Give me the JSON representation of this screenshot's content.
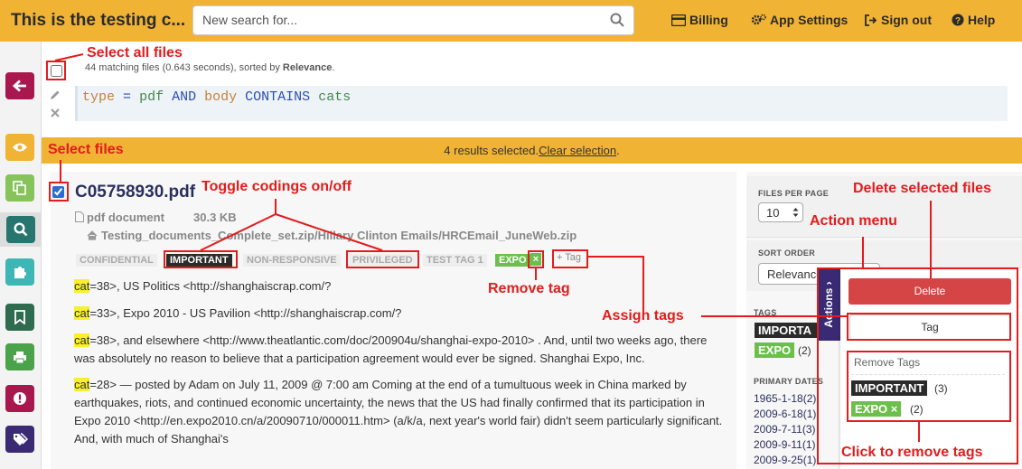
{
  "header": {
    "title": "This is the testing c...",
    "search_placeholder": "New search for...",
    "nav": {
      "billing": "Billing",
      "app_settings": "App Settings",
      "sign_out": "Sign out",
      "help": "Help"
    }
  },
  "results": {
    "summary_prefix": "44 matching files (0.643 seconds), sorted by ",
    "summary_sort": "Relevance",
    "summary_suffix": "."
  },
  "query": {
    "field1": "type",
    "op1": "=",
    "val1": "pdf",
    "and": "AND",
    "field2": "body",
    "op2": "CONTAINS",
    "val2": "cats"
  },
  "selection": {
    "text": "4 results selected.",
    "clear": "Clear selection",
    "end": "."
  },
  "document": {
    "name": "C05758930.pdf",
    "type": "pdf document",
    "size": "30.3 KB",
    "path": "Testing_documents_Complete_set.zip/Hillary Clinton Emails/HRCEmail_JuneWeb.zip",
    "codings": [
      "CONFIDENTIAL",
      "IMPORTANT",
      "NON-RESPONSIVE",
      "PRIVILEGED",
      "TEST TAG 1"
    ],
    "tag_expo": "EXPO",
    "tag_add": "Tag",
    "snippets": [
      {
        "hl": "cat",
        "text": "=38>, US Politics <http://shanghaiscrap.com/?"
      },
      {
        "hl": "cat",
        "text": "=33>, Expo 2010 - US Pavilion <http://shanghaiscrap.com/?"
      },
      {
        "hl": "cat",
        "text": "=38>, and elsewhere <http://www.theatlantic.com/doc/200904u/shanghai-expo-2010> . And, until two weeks ago, there was absolutely no reason to believe that a participation agreement would ever be signed. Shanghai Expo, Inc."
      },
      {
        "hl": "cat",
        "text": "=28> — posted by Adam on July 11, 2009 @ 7:00 am Coming at the end of a tumultuous week in China marked by earthquakes, riots, and continued economic uncertainty, the news that the US had finally confirmed that its participation in Expo 2010 <http://en.expo2010.cn/a/20090710/000011.htm> (a/k/a, next year's world fair) didn't seem particularly significant. And, with much of Shanghai's"
      }
    ]
  },
  "sidebar": {
    "files_per_page_label": "FILES PER PAGE",
    "files_per_page_value": "10",
    "sort_order_label": "SORT ORDER",
    "sort_order_value": "Relevance",
    "tags_label": "TAGS",
    "tag1": "IMPORTA",
    "tag2": "EXPO",
    "tag2_count": "(2)",
    "primary_dates_label": "PRIMARY DATES",
    "dates": [
      "1965-1-18(2)",
      "2009-6-18(1)",
      "2009-7-11(3)",
      "2009-9-11(1)",
      "2009-9-25(1)"
    ]
  },
  "actions": {
    "tab_label": "Actions",
    "delete": "Delete",
    "tag": "Tag",
    "remove_tags_label": "Remove Tags",
    "remove_important": "IMPORTANT",
    "remove_important_count": "(3)",
    "remove_expo": "EXPO",
    "remove_expo_count": "(2)"
  },
  "annotations": {
    "select_all": "Select all files",
    "select_files": "Select files",
    "toggle": "Toggle codings on/off",
    "remove_tag": "Remove tag",
    "assign_tags": "Assign tags",
    "action_menu": "Action menu",
    "delete_selected": "Delete selected files",
    "click_remove": "Click to remove tags"
  },
  "colors": {
    "accent": "#f0b334",
    "annotation": "#e11d1d",
    "expo_green": "#6bbf4a",
    "delete_red": "#d64545",
    "actions_purple": "#3a2a73"
  }
}
